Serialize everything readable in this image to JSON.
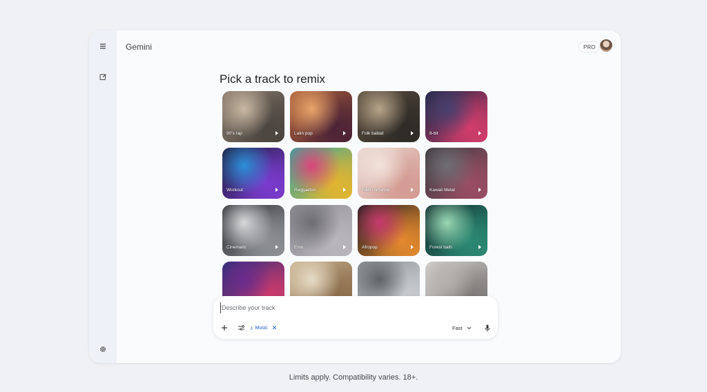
{
  "app": {
    "title": "Gemini",
    "badge": "PRO"
  },
  "sidebar": {
    "items": [
      {
        "icon": "menu-icon"
      },
      {
        "icon": "new-chat-icon"
      },
      {
        "icon": "settings-icon"
      }
    ]
  },
  "main": {
    "heading": "Pick a track to remix",
    "tracks": [
      {
        "label": "90's rap",
        "colors": [
          "#8a7b6e",
          "#4a443f",
          "#c9b8a3"
        ]
      },
      {
        "label": "Latin pop",
        "colors": [
          "#b0653b",
          "#4b2236",
          "#e9a56a"
        ]
      },
      {
        "label": "Folk ballad",
        "colors": [
          "#5c4f40",
          "#2d2a26",
          "#b6a489"
        ]
      },
      {
        "label": "8-bit",
        "colors": [
          "#1c2744",
          "#d23d6b",
          "#46406f"
        ]
      },
      {
        "label": "Workout",
        "colors": [
          "#1a1d38",
          "#7c3bd0",
          "#2c8fd8"
        ]
      },
      {
        "label": "Reggaeton",
        "colors": [
          "#2fa6a0",
          "#e4b52e",
          "#d9467c"
        ]
      },
      {
        "label": "R&B romance",
        "colors": [
          "#e9d8d2",
          "#d39a91",
          "#f2e4dc"
        ]
      },
      {
        "label": "Kawaii Metal",
        "colors": [
          "#3b3b3f",
          "#9a4d64",
          "#6f6f73"
        ]
      },
      {
        "label": "Cinematic",
        "colors": [
          "#2b2d31",
          "#8e9196",
          "#d9dadb"
        ]
      },
      {
        "label": "Emo",
        "colors": [
          "#8d8c92",
          "#b9b7bd",
          "#6f6d74"
        ]
      },
      {
        "label": "Afropop",
        "colors": [
          "#1c1b1f",
          "#e58a2e",
          "#c73a6d"
        ]
      },
      {
        "label": "Forest bath",
        "colors": [
          "#0f2a2c",
          "#2c8a74",
          "#9ad8b4"
        ]
      },
      {
        "label": "",
        "colors": [
          "#2a2f7a",
          "#d13a6b",
          "#6a2b8d"
        ]
      },
      {
        "label": "",
        "colors": [
          "#c9b593",
          "#8a6b4a",
          "#e7dcc6"
        ]
      },
      {
        "label": "",
        "colors": [
          "#8c9196",
          "#c9ccd0",
          "#5f6469"
        ]
      },
      {
        "label": "",
        "colors": [
          "#d7d4d1",
          "#7b7876",
          "#b5b1ad"
        ]
      }
    ]
  },
  "prompt": {
    "placeholder": "Describe your track",
    "chip_label": "Music",
    "model_label": "Fast"
  },
  "footer": {
    "note": "Limits apply. Compatibility varies. 18+."
  }
}
